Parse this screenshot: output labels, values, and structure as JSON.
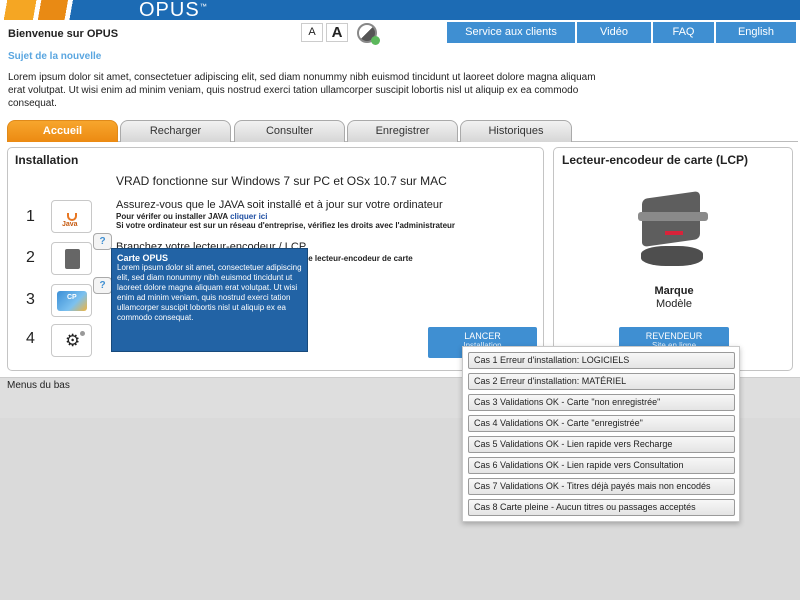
{
  "header": {
    "logo": "OPUS",
    "welcome": "Bienvenue sur OPUS",
    "font_small": "A",
    "font_large": "A",
    "nav": [
      "Service aux clients",
      "Vidéo",
      "FAQ",
      "English"
    ]
  },
  "news": {
    "title": "Sujet de la nouvelle",
    "text": "Lorem ipsum dolor sit amet, consectetuer adipiscing elit, sed diam nonummy nibh euismod tincidunt ut laoreet dolore magna aliquam erat volutpat. Ut wisi enim ad minim veniam, quis nostrud exerci tation ullamcorper suscipit lobortis nisl ut aliquip ex ea commodo consequat."
  },
  "tabs": [
    "Accueil",
    "Recharger",
    "Consulter",
    "Enregistrer",
    "Historiques"
  ],
  "active_tab": "Accueil",
  "installation": {
    "title": "Installation",
    "intro": "VRAD fonctionne sur Windows 7 sur  PC et OSx  10.7 sur MAC",
    "step_numbers": [
      "1",
      "2",
      "3",
      "4"
    ],
    "step1_text": "Assurez-vous que le JAVA soit installé et à jour sur votre ordinateur",
    "step1_sub_prefix": "Pour vérifer ou installer JAVA ",
    "step1_link": "cliquer ici",
    "step1_sub2": "Si votre ordinateur est sur un réseau d'entreprise, vérifiez les droits avec l'administrateur",
    "step2_text": "Branchez votre lecteur-encodeur / LCP",
    "step2_sub": "le lecteur-encodeur de carte",
    "java_label": "Java",
    "card_label": "CP",
    "help_mark": "?",
    "launch_label": "LANCER",
    "launch_sub": "Installation"
  },
  "tooltip": {
    "title": "Carte OPUS",
    "text": "Lorem ipsum dolor sit amet, consectetuer adipiscing elit, sed diam nonummy nibh euismod tincidunt ut laoreet dolore magna aliquam erat volutpat. Ut wisi enim ad minim veniam, quis nostrud exerci tation ullamcorper suscipit lobortis nisl ut aliquip ex ea commodo consequat."
  },
  "reader": {
    "title": "Lecteur-encodeur de carte (LCP)",
    "brand": "Marque",
    "model": "Modèle",
    "reseller_label": "REVENDEUR",
    "reseller_sub": "Site en ligne"
  },
  "bottom_menu": "Menus du bas",
  "cases": [
    "Cas 1 Erreur d'installation: LOGICIELS",
    "Cas 2 Erreur d'installation: MATÉRIEL",
    "Cas 3 Validations OK - Carte \"non enregistrée\"",
    "Cas 4 Validations OK - Carte \"enregistrée\"",
    "Cas 5 Validations OK - Lien rapide vers Recharge",
    "Cas 6 Validations OK - Lien rapide vers Consultation",
    "Cas 7 Validations OK - Titres déjà payés mais non encodés",
    "Cas 8 Carte pleine - Aucun titres ou passages acceptés"
  ]
}
